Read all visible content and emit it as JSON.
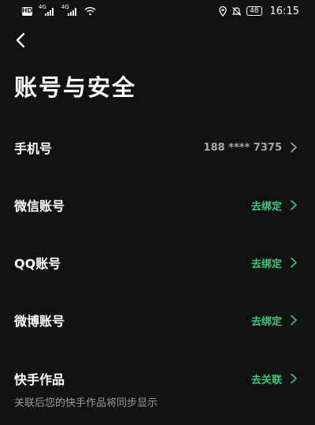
{
  "status_bar": {
    "hd": "HD",
    "network_1": "4G",
    "network_2": "4G",
    "battery": "48",
    "time": "16:15"
  },
  "header": {
    "title": "账号与安全"
  },
  "rows": [
    {
      "label": "手机号",
      "value": "188 **** 7375"
    },
    {
      "label": "微信账号",
      "value": "去绑定"
    },
    {
      "label": "QQ账号",
      "value": "去绑定"
    },
    {
      "label": "微博账号",
      "value": "去绑定"
    },
    {
      "label": "快手作品",
      "value": "去关联",
      "description": "关联后您的快手作品将同步显示"
    }
  ],
  "colors": {
    "background": "#121212",
    "accent_green": "#3dc87a",
    "muted": "#a8a8a8"
  }
}
